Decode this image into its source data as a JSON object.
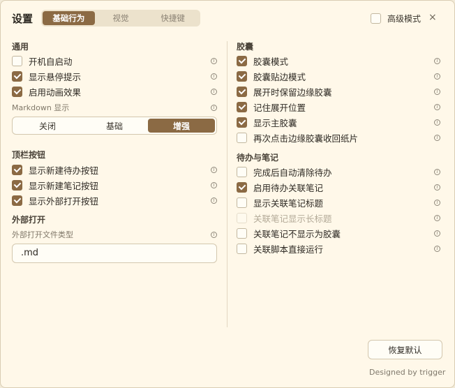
{
  "header": {
    "title": "设置",
    "tabs": [
      {
        "label": "基础行为",
        "active": true
      },
      {
        "label": "视觉",
        "active": false
      },
      {
        "label": "快捷键",
        "active": false
      }
    ],
    "advanced_label": "高级模式",
    "advanced_checked": false,
    "close_glyph": "×"
  },
  "left": {
    "general": {
      "title": "通用",
      "items": [
        {
          "label": "开机自启动",
          "checked": false
        },
        {
          "label": "显示悬停提示",
          "checked": true
        },
        {
          "label": "启用动画效果",
          "checked": true
        }
      ]
    },
    "markdown": {
      "label": "Markdown 显示",
      "options": [
        "关闭",
        "基础",
        "增强"
      ],
      "selected": "增强"
    },
    "topbar": {
      "title": "顶栏按钮",
      "items": [
        {
          "label": "显示新建待办按钮",
          "checked": true
        },
        {
          "label": "显示新建笔记按钮",
          "checked": true
        },
        {
          "label": "显示外部打开按钮",
          "checked": true
        }
      ]
    },
    "external": {
      "title": "外部打开",
      "field_label": "外部打开文件类型",
      "field_value": ".md"
    }
  },
  "right": {
    "capsule": {
      "title": "胶囊",
      "items": [
        {
          "label": "胶囊模式",
          "checked": true
        },
        {
          "label": "胶囊贴边模式",
          "checked": true
        },
        {
          "label": "展开时保留边缘胶囊",
          "checked": true
        },
        {
          "label": "记住展开位置",
          "checked": true
        },
        {
          "label": "显示主胶囊",
          "checked": true
        },
        {
          "label": "再次点击边缘胶囊收回纸片",
          "checked": false
        }
      ]
    },
    "todo": {
      "title": "待办与笔记",
      "items": [
        {
          "label": "完成后自动清除待办",
          "checked": false
        },
        {
          "label": "启用待办关联笔记",
          "checked": true
        },
        {
          "label": "显示关联笔记标题",
          "checked": false
        },
        {
          "label": "关联笔记显示长标题",
          "checked": false,
          "disabled": true
        },
        {
          "label": "关联笔记不显示为胶囊",
          "checked": false
        },
        {
          "label": "关联脚本直接运行",
          "checked": false
        }
      ]
    }
  },
  "footer": {
    "reset_label": "恢复默认",
    "credit": "Designed by trigger"
  },
  "colors": {
    "accent": "#8b6a44",
    "background": "#fff8e9"
  },
  "icons": {
    "info": "info-icon"
  }
}
